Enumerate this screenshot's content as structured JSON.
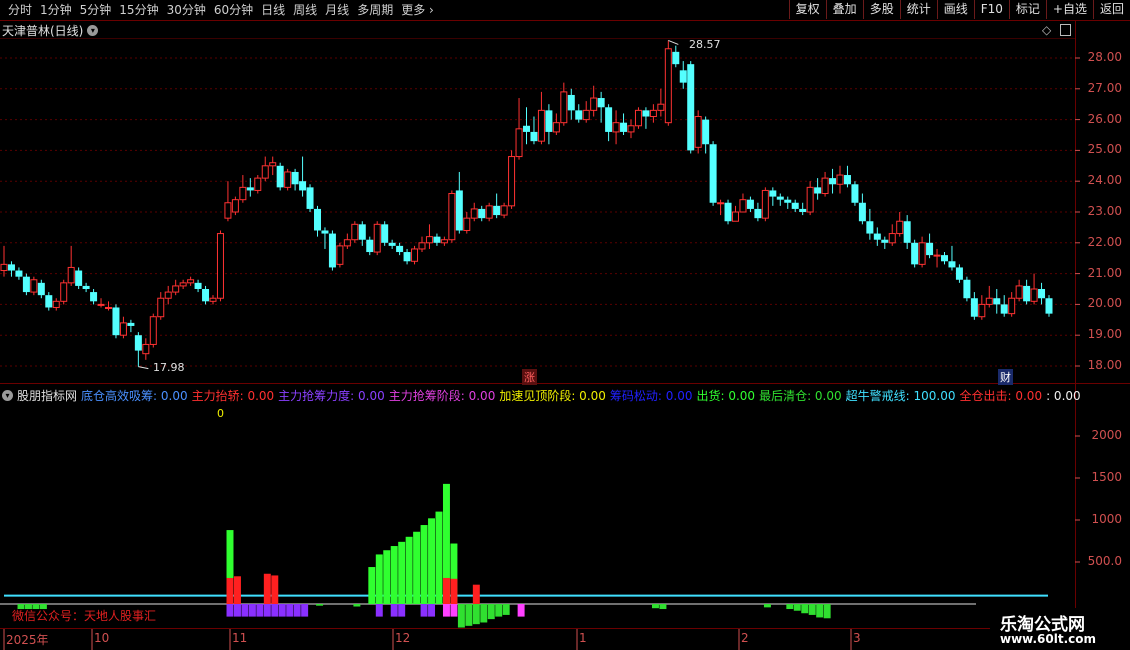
{
  "toolbar": {
    "periods": [
      "分时",
      "1分钟",
      "5分钟",
      "15分钟",
      "30分钟",
      "60分钟",
      "日线",
      "周线",
      "月线",
      "多周期",
      "更多"
    ],
    "more_arrow": "›",
    "actions": [
      "复权",
      "叠加",
      "多股",
      "统计",
      "画线",
      "F10",
      "标记",
      "+自选",
      "返回"
    ]
  },
  "stock": {
    "title": "天津普林(日线)"
  },
  "price_axis": {
    "labels": [
      "28.00",
      "27.00",
      "26.00",
      "25.00",
      "24.00",
      "23.00",
      "22.00",
      "21.00",
      "20.00",
      "19.00",
      "18.00"
    ]
  },
  "price_annotations": {
    "high": "28.57",
    "low": "17.98",
    "zhang": "涨",
    "cai": "财"
  },
  "indicator": {
    "name": "股朋指标网",
    "items": [
      {
        "label": "底仓高效吸筹:",
        "value": "0.00",
        "color": "#4a90ff"
      },
      {
        "label": "主力抬轿:",
        "value": "0.00",
        "color": "#ff3030"
      },
      {
        "label": "主力抢筹力度:",
        "value": "0.00",
        "color": "#8a40ff"
      },
      {
        "label": "主力抢筹阶段:",
        "value": "0.00",
        "color": "#e040e0"
      },
      {
        "label": "加速见顶阶段:",
        "value": "0.00",
        "color": "#f0f000"
      },
      {
        "label": "筹码松动:",
        "value": "0.00",
        "color": "#2020ff"
      },
      {
        "label": "出货:",
        "value": "0.00",
        "color": "#30ff30"
      },
      {
        "label": "最后清仓:",
        "value": "0.00",
        "color": "#30e030"
      },
      {
        "label": "超牛警戒线:",
        "value": "100.00",
        "color": "#40e0ff"
      },
      {
        "label": "全仓出击:",
        "value": "0.00",
        "color": "#ff3030"
      },
      {
        "label": ":",
        "value": "0.00",
        "color": "#f0f0f0"
      }
    ],
    "zero_label": "0",
    "axis_labels": [
      "2000",
      "1500",
      "1000",
      "500.0"
    ]
  },
  "watermark": "微信公众号：天地人股事汇",
  "brand": {
    "name": "乐淘公式网",
    "url": "www.60lt.com"
  },
  "time_axis": {
    "labels": [
      "2025年",
      "10",
      "11",
      "12",
      "1",
      "2",
      "3"
    ]
  },
  "colors": {
    "up": "#ff3232",
    "down": "#54ffff",
    "grid": "#6a0000",
    "axis_text": "#d05050"
  },
  "chart_data": [
    {
      "type": "candlestick",
      "title": "天津普林(日线)",
      "ylim": [
        17.6,
        28.8
      ],
      "y_ticks": [
        28,
        27,
        26,
        25,
        24,
        23,
        22,
        21,
        20,
        19,
        18
      ],
      "candles": [
        [
          21.1,
          21.3,
          20.9,
          21.9
        ],
        [
          21.3,
          21.1,
          20.9,
          21.4
        ],
        [
          21.1,
          20.9,
          20.8,
          21.2
        ],
        [
          20.9,
          20.4,
          20.3,
          21.0
        ],
        [
          20.4,
          20.8,
          20.3,
          20.9
        ],
        [
          20.7,
          20.3,
          20.2,
          20.8
        ],
        [
          20.3,
          19.9,
          19.8,
          20.4
        ],
        [
          19.9,
          20.1,
          19.8,
          20.2
        ],
        [
          20.1,
          20.7,
          20.0,
          20.8
        ],
        [
          20.7,
          21.2,
          20.6,
          21.9
        ],
        [
          21.1,
          20.6,
          20.5,
          21.2
        ],
        [
          20.6,
          20.5,
          20.4,
          20.7
        ],
        [
          20.4,
          20.1,
          20.0,
          20.5
        ],
        [
          20.0,
          20.0,
          19.9,
          20.2
        ],
        [
          19.9,
          19.9,
          19.8,
          20.1
        ],
        [
          19.9,
          19.0,
          18.9,
          20.0
        ],
        [
          19.0,
          19.4,
          18.9,
          19.6
        ],
        [
          19.4,
          19.3,
          19.1,
          19.5
        ],
        [
          19.0,
          18.5,
          17.98,
          19.1
        ],
        [
          18.4,
          18.7,
          18.2,
          18.9
        ],
        [
          18.7,
          19.6,
          18.6,
          19.7
        ],
        [
          19.6,
          20.2,
          19.5,
          20.4
        ],
        [
          20.2,
          20.4,
          20.0,
          20.6
        ],
        [
          20.4,
          20.6,
          20.3,
          20.8
        ],
        [
          20.6,
          20.7,
          20.5,
          20.8
        ],
        [
          20.7,
          20.8,
          20.6,
          20.9
        ],
        [
          20.7,
          20.5,
          20.4,
          20.8
        ],
        [
          20.5,
          20.1,
          20.0,
          20.6
        ],
        [
          20.1,
          20.2,
          20.0,
          20.3
        ],
        [
          20.2,
          22.3,
          20.1,
          22.4
        ],
        [
          22.8,
          23.3,
          22.7,
          24.0
        ],
        [
          23.0,
          23.4,
          22.9,
          23.5
        ],
        [
          23.4,
          23.8,
          23.3,
          24.2
        ],
        [
          23.8,
          23.7,
          23.5,
          24.1
        ],
        [
          23.7,
          24.1,
          23.6,
          24.2
        ],
        [
          24.1,
          24.5,
          24.0,
          24.8
        ],
        [
          24.5,
          24.6,
          24.2,
          24.8
        ],
        [
          24.5,
          23.8,
          23.7,
          24.6
        ],
        [
          23.8,
          24.3,
          23.7,
          24.4
        ],
        [
          24.3,
          23.9,
          23.7,
          24.4
        ],
        [
          24.0,
          23.7,
          23.5,
          24.8
        ],
        [
          23.8,
          23.1,
          23.0,
          23.9
        ],
        [
          23.1,
          22.4,
          22.2,
          23.2
        ],
        [
          22.4,
          22.3,
          21.8,
          22.5
        ],
        [
          22.3,
          21.2,
          21.1,
          22.4
        ],
        [
          21.3,
          21.9,
          21.2,
          22.0
        ],
        [
          21.9,
          22.1,
          21.8,
          22.3
        ],
        [
          22.1,
          22.6,
          22.0,
          22.7
        ],
        [
          22.6,
          22.1,
          21.9,
          22.7
        ],
        [
          22.1,
          21.7,
          21.6,
          22.2
        ],
        [
          21.7,
          22.6,
          21.6,
          22.7
        ],
        [
          22.6,
          22.0,
          21.9,
          22.7
        ],
        [
          22.0,
          21.9,
          21.8,
          22.1
        ],
        [
          21.9,
          21.7,
          21.6,
          22.0
        ],
        [
          21.7,
          21.4,
          21.3,
          21.8
        ],
        [
          21.4,
          21.8,
          21.3,
          21.9
        ],
        [
          21.8,
          22.0,
          21.7,
          22.2
        ],
        [
          22.0,
          22.2,
          21.8,
          22.6
        ],
        [
          22.2,
          22.0,
          21.9,
          22.3
        ],
        [
          22.0,
          22.1,
          21.9,
          22.2
        ],
        [
          22.1,
          23.6,
          22.0,
          23.7
        ],
        [
          23.7,
          22.4,
          22.3,
          24.3
        ],
        [
          22.4,
          22.8,
          22.3,
          23.0
        ],
        [
          22.8,
          23.1,
          22.7,
          23.3
        ],
        [
          23.1,
          22.8,
          22.7,
          23.2
        ],
        [
          22.8,
          23.2,
          22.7,
          23.3
        ],
        [
          23.2,
          22.9,
          22.8,
          23.6
        ],
        [
          22.9,
          23.2,
          22.8,
          23.3
        ],
        [
          23.2,
          24.8,
          23.1,
          25.0
        ],
        [
          24.8,
          25.7,
          24.7,
          26.7
        ],
        [
          25.8,
          25.6,
          25.2,
          26.4
        ],
        [
          25.6,
          25.3,
          25.2,
          26.1
        ],
        [
          25.3,
          26.3,
          25.2,
          26.9
        ],
        [
          26.3,
          25.6,
          25.2,
          26.5
        ],
        [
          25.6,
          25.9,
          25.5,
          26.2
        ],
        [
          25.9,
          26.9,
          25.8,
          27.2
        ],
        [
          26.8,
          26.3,
          26.0,
          27.0
        ],
        [
          26.3,
          26.0,
          25.9,
          26.5
        ],
        [
          26.0,
          26.3,
          25.9,
          26.6
        ],
        [
          26.3,
          26.7,
          26.1,
          27.1
        ],
        [
          26.7,
          26.4,
          25.9,
          26.9
        ],
        [
          26.4,
          25.6,
          25.3,
          26.5
        ],
        [
          25.6,
          25.9,
          25.2,
          26.3
        ],
        [
          25.9,
          25.6,
          25.5,
          26.2
        ],
        [
          25.6,
          25.8,
          25.4,
          26.0
        ],
        [
          25.8,
          26.3,
          25.7,
          26.4
        ],
        [
          26.3,
          26.1,
          25.7,
          26.4
        ],
        [
          26.1,
          26.3,
          25.9,
          26.5
        ],
        [
          26.3,
          26.5,
          26.1,
          27.0
        ],
        [
          25.9,
          28.3,
          25.8,
          28.57
        ],
        [
          28.2,
          27.8,
          27.7,
          28.4
        ],
        [
          27.6,
          27.2,
          27.0,
          27.9
        ],
        [
          27.8,
          25.0,
          24.9,
          27.9
        ],
        [
          25.1,
          26.1,
          24.9,
          26.3
        ],
        [
          26.0,
          25.2,
          24.9,
          26.1
        ],
        [
          25.2,
          23.3,
          23.2,
          25.3
        ],
        [
          23.3,
          23.3,
          22.9,
          23.4
        ],
        [
          23.3,
          22.7,
          22.6,
          23.4
        ],
        [
          22.7,
          23.0,
          22.9,
          23.2
        ],
        [
          23.0,
          23.4,
          23.1,
          23.6
        ],
        [
          23.4,
          23.1,
          23.0,
          23.5
        ],
        [
          23.1,
          22.8,
          22.7,
          23.3
        ],
        [
          22.8,
          23.7,
          22.7,
          23.8
        ],
        [
          23.7,
          23.5,
          23.2,
          23.8
        ],
        [
          23.5,
          23.4,
          23.2,
          23.6
        ],
        [
          23.4,
          23.3,
          23.1,
          23.5
        ],
        [
          23.3,
          23.1,
          23.0,
          23.4
        ],
        [
          23.1,
          23.0,
          22.9,
          23.3
        ],
        [
          23.0,
          23.8,
          22.9,
          24.0
        ],
        [
          23.8,
          23.6,
          23.4,
          24.1
        ],
        [
          23.6,
          24.1,
          23.5,
          24.3
        ],
        [
          24.1,
          23.9,
          23.6,
          24.4
        ],
        [
          23.9,
          24.2,
          23.6,
          24.5
        ],
        [
          24.2,
          23.9,
          23.8,
          24.5
        ],
        [
          23.9,
          23.3,
          23.2,
          24.0
        ],
        [
          23.3,
          22.7,
          22.6,
          23.6
        ],
        [
          22.7,
          22.3,
          22.1,
          23.1
        ],
        [
          22.3,
          22.1,
          21.9,
          22.5
        ],
        [
          22.1,
          22.0,
          21.8,
          22.2
        ],
        [
          22.0,
          22.3,
          21.9,
          22.6
        ],
        [
          22.3,
          22.7,
          22.2,
          23.0
        ],
        [
          22.7,
          22.0,
          21.8,
          22.9
        ],
        [
          22.0,
          21.3,
          21.2,
          22.1
        ],
        [
          21.3,
          22.0,
          21.2,
          22.2
        ],
        [
          22.0,
          21.6,
          21.5,
          22.3
        ],
        [
          21.6,
          21.6,
          21.2,
          21.8
        ],
        [
          21.6,
          21.4,
          21.3,
          21.7
        ],
        [
          21.4,
          21.2,
          21.1,
          21.9
        ],
        [
          21.2,
          20.8,
          20.7,
          21.3
        ],
        [
          20.8,
          20.2,
          20.1,
          20.9
        ],
        [
          20.2,
          19.6,
          19.5,
          20.4
        ],
        [
          19.6,
          20.0,
          19.5,
          20.3
        ],
        [
          20.0,
          20.2,
          19.9,
          20.6
        ],
        [
          20.2,
          20.0,
          19.7,
          20.5
        ],
        [
          20.0,
          19.7,
          19.6,
          20.3
        ],
        [
          19.7,
          20.2,
          19.6,
          20.4
        ],
        [
          20.2,
          20.6,
          20.1,
          20.8
        ],
        [
          20.6,
          20.1,
          20.0,
          20.8
        ],
        [
          20.1,
          20.5,
          20.0,
          21.0
        ],
        [
          20.5,
          20.2,
          20.0,
          20.7
        ],
        [
          20.2,
          19.7,
          19.6,
          20.3
        ]
      ],
      "candle_format": [
        "open",
        "close",
        "low",
        "high"
      ],
      "high_label": "28.57",
      "low_label": "17.98"
    },
    {
      "type": "bar",
      "title": "股朋指标网",
      "ylim": [
        -300,
        2500
      ],
      "y_ticks": [
        2000,
        1500,
        1000,
        500
      ],
      "reference_line": 100,
      "series": [
        {
          "name": "出货",
          "color": "#30ff30",
          "bars": [
            [
              28,
              880
            ],
            [
              47,
              440
            ],
            [
              48,
              590
            ],
            [
              49,
              640
            ],
            [
              50,
              690
            ],
            [
              51,
              740
            ],
            [
              52,
              800
            ],
            [
              53,
              860
            ],
            [
              54,
              940
            ],
            [
              55,
              1020
            ],
            [
              56,
              1100
            ],
            [
              57,
              1430
            ],
            [
              58,
              720
            ]
          ]
        },
        {
          "name": "主力抬轿",
          "color": "#ff2020",
          "bars": [
            [
              28,
              310
            ],
            [
              29,
              330
            ],
            [
              33,
              360
            ],
            [
              34,
              340
            ],
            [
              57,
              310
            ],
            [
              58,
              300
            ],
            [
              61,
              230
            ]
          ]
        },
        {
          "name": "主力抢筹力度",
          "color": "#8a30ff",
          "bars": [
            [
              28,
              -150
            ],
            [
              29,
              -150
            ],
            [
              30,
              -150
            ],
            [
              31,
              -150
            ],
            [
              32,
              -150
            ],
            [
              33,
              -150
            ],
            [
              34,
              -150
            ],
            [
              35,
              -150
            ],
            [
              36,
              -150
            ],
            [
              37,
              -150
            ],
            [
              38,
              -150
            ],
            [
              48,
              -150
            ],
            [
              50,
              -150
            ],
            [
              51,
              -150
            ],
            [
              54,
              -150
            ],
            [
              55,
              -150
            ]
          ]
        },
        {
          "name": "主力抢筹阶段",
          "color": "#ff40ff",
          "bars": [
            [
              57,
              -150
            ],
            [
              58,
              -150
            ],
            [
              67,
              -150
            ]
          ]
        },
        {
          "name": "最后清仓",
          "color": "#30e030",
          "bars": [
            [
              0,
              -60
            ],
            [
              1,
              -60
            ],
            [
              2,
              -60
            ],
            [
              3,
              -60
            ],
            [
              40,
              -20
            ],
            [
              45,
              -30
            ],
            [
              59,
              -280
            ],
            [
              60,
              -260
            ],
            [
              61,
              -240
            ],
            [
              62,
              -220
            ],
            [
              63,
              -180
            ],
            [
              64,
              -150
            ],
            [
              65,
              -130
            ],
            [
              85,
              -50
            ],
            [
              86,
              -60
            ],
            [
              100,
              -40
            ],
            [
              103,
              -60
            ],
            [
              104,
              -80
            ],
            [
              105,
              -110
            ],
            [
              106,
              -130
            ],
            [
              107,
              -160
            ],
            [
              108,
              -170
            ]
          ]
        }
      ]
    }
  ]
}
